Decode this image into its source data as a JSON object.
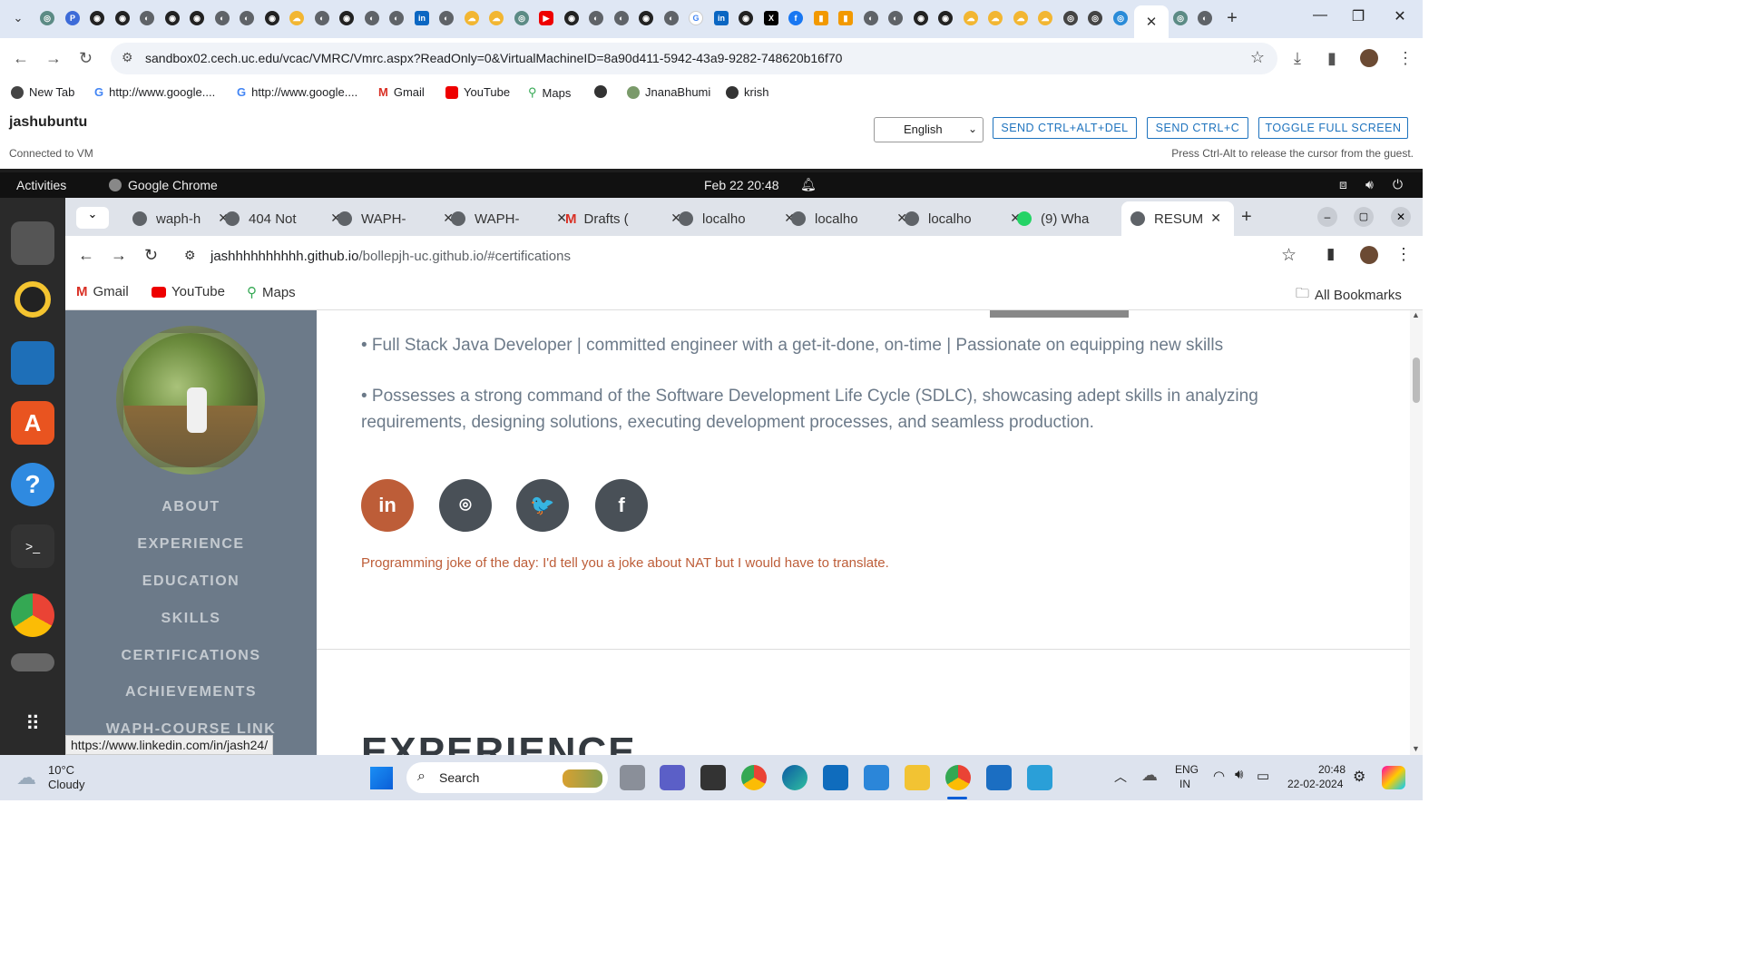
{
  "outer_browser": {
    "active_tab_close": "✕",
    "new_tab": "+",
    "url": "sandbox02.cech.uc.edu/vcac/VMRC/Vmrc.aspx?ReadOnly=0&VirtualMachineID=8a90d411-5942-43a9-9282-748620b16f70",
    "bookmarks": [
      "New Tab",
      "http://www.google....",
      "http://www.google....",
      "Gmail",
      "YouTube",
      "Maps",
      "",
      "JnanaBhumi",
      "krish"
    ]
  },
  "vmrc": {
    "vm_name": "jashubuntu",
    "status": "Connected to VM",
    "language": "English",
    "buttons": [
      "SEND CTRL+ALT+DEL",
      "SEND CTRL+C",
      "TOGGLE FULL SCREEN"
    ],
    "hint": "Press Ctrl-Alt to release the cursor from the guest."
  },
  "ubuntu": {
    "activities": "Activities",
    "app_name": "Google Chrome",
    "clock": "Feb 22  20:48"
  },
  "inner_browser": {
    "tabs": [
      "waph-h",
      "404 Not",
      "WAPH-",
      "WAPH-",
      "Drafts (",
      "localho",
      "localho",
      "localho",
      "(9) Wha",
      "RESUM"
    ],
    "url_host": "jashhhhhhhhhh.github.io",
    "url_path": "/bollepjh-uc.github.io/#certifications",
    "bookmarks": [
      "Gmail",
      "YouTube",
      "Maps"
    ],
    "all_bookmarks": "All Bookmarks"
  },
  "page": {
    "nav": [
      "ABOUT",
      "EXPERIENCE",
      "EDUCATION",
      "SKILLS",
      "CERTIFICATIONS",
      "ACHIEVEMENTS",
      "WAPH-COURSE LINK"
    ],
    "bullet1": "• Full Stack Java Developer | committed engineer with a get-it-done, on-time | Passionate on equipping new skills",
    "bullet2_line1": "• Possesses a strong command of the Software Development Life Cycle (SDLC), showcasing adept skills in analyzing",
    "bullet2_line2": "requirements, designing solutions, executing development processes, and seamless production.",
    "social": [
      "in",
      "⌾",
      "🐦",
      "f"
    ],
    "joke": "Programming joke of the day: I'd tell you a joke about NAT but I would have to translate.",
    "next_section": "EXPERIENCE",
    "status_url": "https://www.linkedin.com/in/jash24/"
  },
  "taskbar": {
    "weather_temp": "10°C",
    "weather_desc": "Cloudy",
    "search": "Search",
    "lang1": "ENG",
    "lang2": "IN",
    "time": "20:48",
    "date": "22-02-2024"
  },
  "colors": {
    "sidebar": "#6c7a89",
    "accent": "#bd5d38",
    "social_bg": "#495057"
  }
}
